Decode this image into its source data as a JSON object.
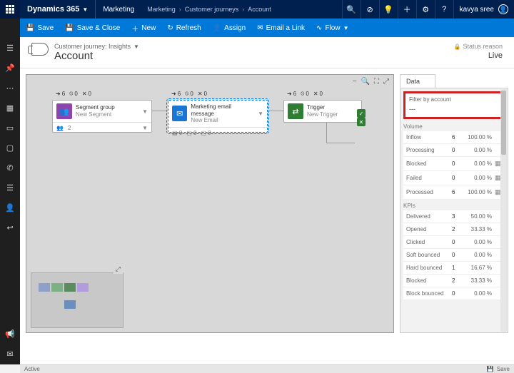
{
  "top": {
    "brand": "Dynamics 365",
    "module": "Marketing",
    "crumbs": [
      "Marketing",
      "Customer journeys",
      "Account"
    ],
    "user": "kavya sree"
  },
  "cmd": {
    "save": "Save",
    "saveclose": "Save & Close",
    "new": "New",
    "refresh": "Refresh",
    "assign": "Assign",
    "email": "Email a Link",
    "flow": "Flow"
  },
  "head": {
    "sub": "Customer journey: Insights",
    "title": "Account",
    "status_label": "Status reason",
    "status_value": "Live"
  },
  "nodes": {
    "seg": {
      "title": "Segment group",
      "sub": "New Segment",
      "s1": "6",
      "s2": "0",
      "s3": "0",
      "b1": "2"
    },
    "email": {
      "title": "Marketing email message",
      "sub": "New Email",
      "s1": "6",
      "s2": "0",
      "s3": "0",
      "b1": "0",
      "b2": "0",
      "b3": "0"
    },
    "trig": {
      "title": "Trigger",
      "sub": "New Trigger",
      "s1": "6",
      "s2": "0",
      "s3": "0"
    }
  },
  "panel": {
    "tab": "Data",
    "filter_label": "Filter by account",
    "filter_value": "---",
    "volume_label": "Volume",
    "volume": [
      {
        "l": "Inflow",
        "v": "6",
        "p": "100.00 %"
      },
      {
        "l": "Processing",
        "v": "0",
        "p": "0.00 %"
      },
      {
        "l": "Blocked",
        "v": "0",
        "p": "0.00 %",
        "i": "1"
      },
      {
        "l": "Failed",
        "v": "0",
        "p": "0.00 %",
        "i": "1"
      },
      {
        "l": "Processed",
        "v": "6",
        "p": "100.00 %",
        "i": "1"
      }
    ],
    "kpi_label": "KPIs",
    "kpis": [
      {
        "l": "Delivered",
        "v": "3",
        "p": "50.00 %"
      },
      {
        "l": "Opened",
        "v": "2",
        "p": "33.33 %"
      },
      {
        "l": "Clicked",
        "v": "0",
        "p": "0.00 %"
      },
      {
        "l": "Soft bounced",
        "v": "0",
        "p": "0.00 %"
      },
      {
        "l": "Hard bounced",
        "v": "1",
        "p": "16.67 %"
      },
      {
        "l": "Blocked",
        "v": "2",
        "p": "33.33 %"
      },
      {
        "l": "Block bounced",
        "v": "0",
        "p": "0.00 %"
      }
    ]
  },
  "status": {
    "active": "Active",
    "save": "Save"
  }
}
